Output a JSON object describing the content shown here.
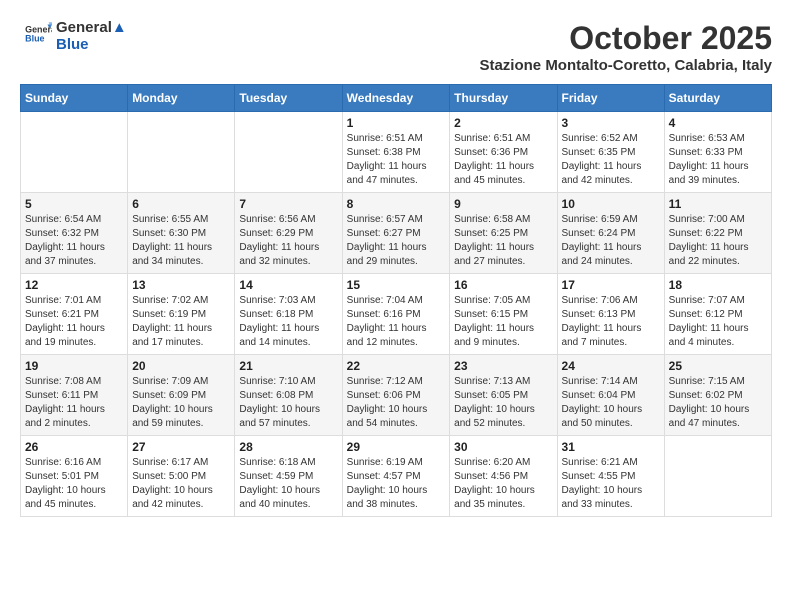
{
  "header": {
    "logo_line1": "General",
    "logo_line2": "Blue",
    "month_title": "October 2025",
    "location": "Stazione Montalto-Coretto, Calabria, Italy"
  },
  "days_of_week": [
    "Sunday",
    "Monday",
    "Tuesday",
    "Wednesday",
    "Thursday",
    "Friday",
    "Saturday"
  ],
  "weeks": [
    [
      {
        "day": "",
        "info": ""
      },
      {
        "day": "",
        "info": ""
      },
      {
        "day": "",
        "info": ""
      },
      {
        "day": "1",
        "info": "Sunrise: 6:51 AM\nSunset: 6:38 PM\nDaylight: 11 hours and 47 minutes."
      },
      {
        "day": "2",
        "info": "Sunrise: 6:51 AM\nSunset: 6:36 PM\nDaylight: 11 hours and 45 minutes."
      },
      {
        "day": "3",
        "info": "Sunrise: 6:52 AM\nSunset: 6:35 PM\nDaylight: 11 hours and 42 minutes."
      },
      {
        "day": "4",
        "info": "Sunrise: 6:53 AM\nSunset: 6:33 PM\nDaylight: 11 hours and 39 minutes."
      }
    ],
    [
      {
        "day": "5",
        "info": "Sunrise: 6:54 AM\nSunset: 6:32 PM\nDaylight: 11 hours and 37 minutes."
      },
      {
        "day": "6",
        "info": "Sunrise: 6:55 AM\nSunset: 6:30 PM\nDaylight: 11 hours and 34 minutes."
      },
      {
        "day": "7",
        "info": "Sunrise: 6:56 AM\nSunset: 6:29 PM\nDaylight: 11 hours and 32 minutes."
      },
      {
        "day": "8",
        "info": "Sunrise: 6:57 AM\nSunset: 6:27 PM\nDaylight: 11 hours and 29 minutes."
      },
      {
        "day": "9",
        "info": "Sunrise: 6:58 AM\nSunset: 6:25 PM\nDaylight: 11 hours and 27 minutes."
      },
      {
        "day": "10",
        "info": "Sunrise: 6:59 AM\nSunset: 6:24 PM\nDaylight: 11 hours and 24 minutes."
      },
      {
        "day": "11",
        "info": "Sunrise: 7:00 AM\nSunset: 6:22 PM\nDaylight: 11 hours and 22 minutes."
      }
    ],
    [
      {
        "day": "12",
        "info": "Sunrise: 7:01 AM\nSunset: 6:21 PM\nDaylight: 11 hours and 19 minutes."
      },
      {
        "day": "13",
        "info": "Sunrise: 7:02 AM\nSunset: 6:19 PM\nDaylight: 11 hours and 17 minutes."
      },
      {
        "day": "14",
        "info": "Sunrise: 7:03 AM\nSunset: 6:18 PM\nDaylight: 11 hours and 14 minutes."
      },
      {
        "day": "15",
        "info": "Sunrise: 7:04 AM\nSunset: 6:16 PM\nDaylight: 11 hours and 12 minutes."
      },
      {
        "day": "16",
        "info": "Sunrise: 7:05 AM\nSunset: 6:15 PM\nDaylight: 11 hours and 9 minutes."
      },
      {
        "day": "17",
        "info": "Sunrise: 7:06 AM\nSunset: 6:13 PM\nDaylight: 11 hours and 7 minutes."
      },
      {
        "day": "18",
        "info": "Sunrise: 7:07 AM\nSunset: 6:12 PM\nDaylight: 11 hours and 4 minutes."
      }
    ],
    [
      {
        "day": "19",
        "info": "Sunrise: 7:08 AM\nSunset: 6:11 PM\nDaylight: 11 hours and 2 minutes."
      },
      {
        "day": "20",
        "info": "Sunrise: 7:09 AM\nSunset: 6:09 PM\nDaylight: 10 hours and 59 minutes."
      },
      {
        "day": "21",
        "info": "Sunrise: 7:10 AM\nSunset: 6:08 PM\nDaylight: 10 hours and 57 minutes."
      },
      {
        "day": "22",
        "info": "Sunrise: 7:12 AM\nSunset: 6:06 PM\nDaylight: 10 hours and 54 minutes."
      },
      {
        "day": "23",
        "info": "Sunrise: 7:13 AM\nSunset: 6:05 PM\nDaylight: 10 hours and 52 minutes."
      },
      {
        "day": "24",
        "info": "Sunrise: 7:14 AM\nSunset: 6:04 PM\nDaylight: 10 hours and 50 minutes."
      },
      {
        "day": "25",
        "info": "Sunrise: 7:15 AM\nSunset: 6:02 PM\nDaylight: 10 hours and 47 minutes."
      }
    ],
    [
      {
        "day": "26",
        "info": "Sunrise: 6:16 AM\nSunset: 5:01 PM\nDaylight: 10 hours and 45 minutes."
      },
      {
        "day": "27",
        "info": "Sunrise: 6:17 AM\nSunset: 5:00 PM\nDaylight: 10 hours and 42 minutes."
      },
      {
        "day": "28",
        "info": "Sunrise: 6:18 AM\nSunset: 4:59 PM\nDaylight: 10 hours and 40 minutes."
      },
      {
        "day": "29",
        "info": "Sunrise: 6:19 AM\nSunset: 4:57 PM\nDaylight: 10 hours and 38 minutes."
      },
      {
        "day": "30",
        "info": "Sunrise: 6:20 AM\nSunset: 4:56 PM\nDaylight: 10 hours and 35 minutes."
      },
      {
        "day": "31",
        "info": "Sunrise: 6:21 AM\nSunset: 4:55 PM\nDaylight: 10 hours and 33 minutes."
      },
      {
        "day": "",
        "info": ""
      }
    ]
  ]
}
